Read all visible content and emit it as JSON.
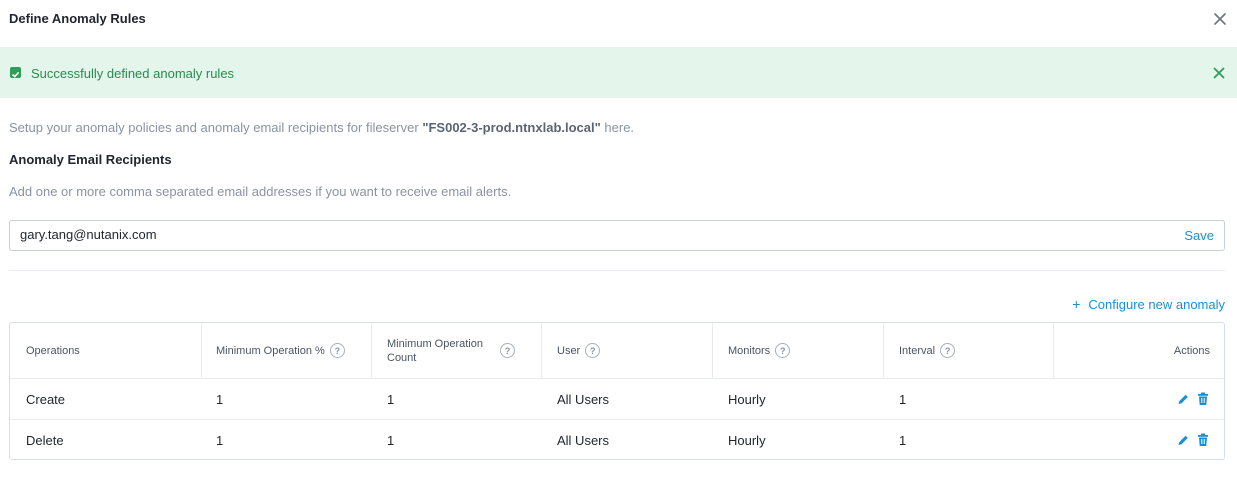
{
  "dialog": {
    "title": "Define Anomaly Rules"
  },
  "alert": {
    "message": "Successfully defined anomaly rules"
  },
  "intro": {
    "prefix": "Setup your anomaly policies and anomaly email recipients for fileserver ",
    "fileserver": "\"FS002-3-prod.ntnxlab.local\"",
    "suffix": " here."
  },
  "recipients": {
    "title": "Anomaly Email Recipients",
    "help": "Add one or more comma separated email addresses if you want to receive email alerts.",
    "value": "gary.tang@nutanix.com",
    "save_label": "Save"
  },
  "configure_label": "Configure new anomaly",
  "table": {
    "headers": {
      "operations": "Operations",
      "min_pct": "Minimum Operation %",
      "min_count_1": "Minimum Operation",
      "min_count_2": "Count",
      "user": "User",
      "monitors": "Monitors",
      "interval": "Interval",
      "actions": "Actions"
    },
    "rows": [
      {
        "operation": "Create",
        "min_pct": "1",
        "min_count": "1",
        "user": "All Users",
        "monitors": "Hourly",
        "interval": "1"
      },
      {
        "operation": "Delete",
        "min_pct": "1",
        "min_count": "1",
        "user": "All Users",
        "monitors": "Hourly",
        "interval": "1"
      }
    ]
  },
  "colors": {
    "accent": "#1b8fd6",
    "success_bg": "#e4f5ec",
    "success_text": "#2a8a50"
  }
}
